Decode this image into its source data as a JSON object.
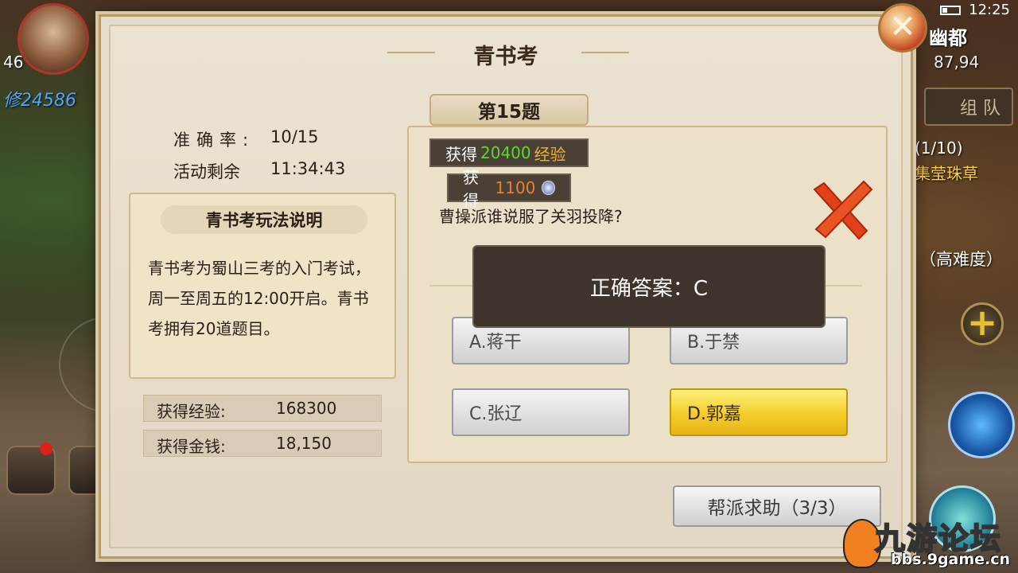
{
  "hud": {
    "level": "46",
    "power": "修24586",
    "time": "12:25",
    "map_name": "幽都",
    "map_coords": "87,94",
    "team_label": "组 队",
    "quest_progress": "(1/10)",
    "quest_name": "集莹珠草",
    "difficulty": "（高难度）"
  },
  "dialog": {
    "title": "青书考",
    "close_glyph": "✕",
    "stats": {
      "accuracy_label": "准确率:",
      "accuracy_value": "10/15",
      "remaining_label": "活动剩余",
      "remaining_value": "11:34:43"
    },
    "rules": {
      "title": "青书考玩法说明",
      "text": "青书考为蜀山三考的入门考试，周一至周五的12:00开启。青书考拥有20道题目。"
    },
    "rewards": {
      "exp_label": "获得经验:",
      "exp_value": "168300",
      "money_label": "获得金钱:",
      "money_value": "18,150"
    },
    "question": {
      "header": "第15题",
      "gain_exp_prefix": "获得",
      "gain_exp_value": "20400",
      "gain_exp_unit": "经验",
      "gain_money_prefix": "获得",
      "gain_money_value": "1100",
      "text": "曹操派谁说服了关羽投降?",
      "correct_answer": "正确答案：C",
      "options": [
        {
          "label": "A.蒋干"
        },
        {
          "label": "B.于禁"
        },
        {
          "label": "C.张辽"
        },
        {
          "label": "D.郭嘉"
        }
      ]
    },
    "help_button": "帮派求助（3/3）"
  },
  "watermark": {
    "title": "九游论坛",
    "url": "bbs.9game.cn"
  },
  "colors": {
    "selected_option": "#f4cc2a",
    "exp_green": "#5cd830",
    "money_orange": "#e88030",
    "wrong_mark": "#e0401a"
  }
}
